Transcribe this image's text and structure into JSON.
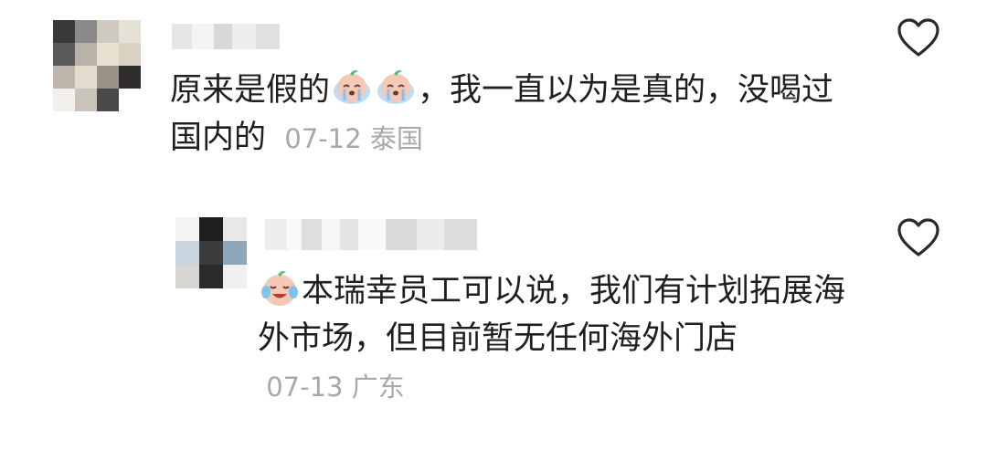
{
  "colors": {
    "text": "#1f1f1f",
    "meta": "#a8a8a8",
    "icon_stroke": "#2a2a2a",
    "emoji_face": "#f6c8b6",
    "emoji_tear": "#7ec3ef",
    "emoji_leaf": "#5dbb7a"
  },
  "comment": {
    "text": "原来是假的",
    "text_after_emoji": "，我一直以为是真的，没喝过国内的",
    "date": "07-12",
    "location": "泰国",
    "emoji_name": "crying-peach-emoji",
    "like_icon": "heart-outline-icon"
  },
  "reply": {
    "text": "本瑞幸员工可以说，我们有计划拓展海外市场，但目前暂无任何海外门店",
    "date": "07-13",
    "location": "广东",
    "emoji_name": "laugh-cry-peach-emoji",
    "like_icon": "heart-outline-icon"
  }
}
